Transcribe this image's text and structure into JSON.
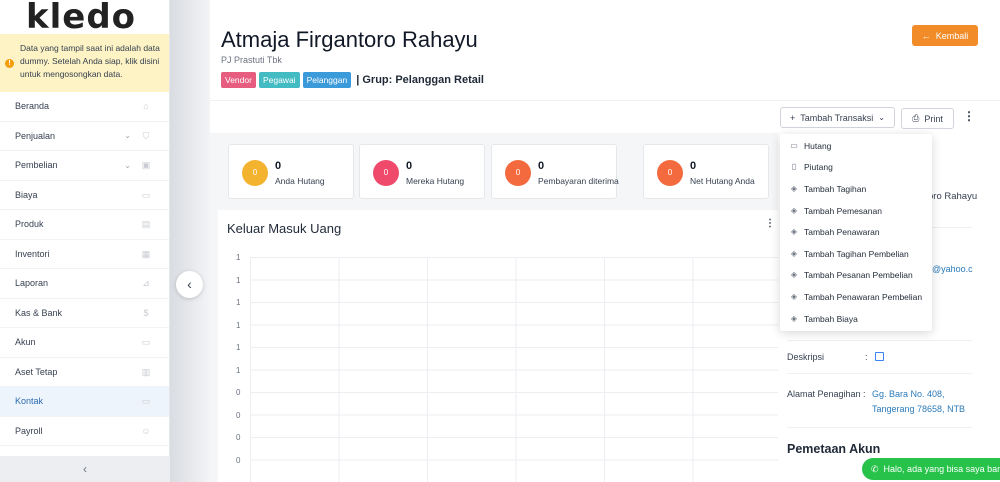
{
  "logo": "kledo",
  "notice": {
    "text": "Data yang tampil saat ini adalah data dummy. Setelah Anda siap, klik disini untuk mengosongkan data."
  },
  "sidebar": {
    "items": [
      {
        "label": "Beranda",
        "icon": "home-icon",
        "chevron": ""
      },
      {
        "label": "Penjualan",
        "icon": "basket-icon",
        "chevron": "⌄"
      },
      {
        "label": "Pembelian",
        "icon": "bag-icon",
        "chevron": "⌄"
      },
      {
        "label": "Biaya",
        "icon": "card-icon",
        "chevron": ""
      },
      {
        "label": "Produk",
        "icon": "box-icon",
        "chevron": ""
      },
      {
        "label": "Inventori",
        "icon": "inventory-icon",
        "chevron": ""
      },
      {
        "label": "Laporan",
        "icon": "chart-icon",
        "chevron": ""
      },
      {
        "label": "Kas & Bank",
        "icon": "dollar-icon",
        "chevron": ""
      },
      {
        "label": "Akun",
        "icon": "book-icon",
        "chevron": ""
      },
      {
        "label": "Aset Tetap",
        "icon": "building-icon",
        "chevron": ""
      },
      {
        "label": "Kontak",
        "icon": "contact-icon",
        "chevron": ""
      },
      {
        "label": "Payroll",
        "icon": "payroll-icon",
        "chevron": ""
      }
    ],
    "active_index": 10,
    "collapse_glyph": "‹"
  },
  "header": {
    "title": "Atmaja Firgantoro Rahayu",
    "subtitle": "PJ Prastuti Tbk",
    "tags": [
      "Vendor",
      "Pegawai",
      "Pelanggan"
    ],
    "group": "| Grup: Pelanggan Retail",
    "back_label": "Kembali"
  },
  "toolbar": {
    "tambah_label": "Tambah Transaksi",
    "print_label": "Print"
  },
  "stats": [
    {
      "value": "0",
      "label": "Anda Hutang",
      "circle_text": "0",
      "color": "#f4b32e"
    },
    {
      "value": "0",
      "label": "Mereka Hutang",
      "circle_text": "0",
      "color": "#ef4a6c"
    },
    {
      "value": "0",
      "label": "Pembayaran diterima",
      "circle_text": "0",
      "color": "#f26a3e"
    },
    {
      "value": "0",
      "label": "Net Hutang Anda",
      "circle_text": "0",
      "color": "#f26a3e"
    }
  ],
  "chart_data": {
    "type": "line",
    "title": "Keluar Masuk Uang",
    "y_tick_labels": [
      "1",
      "1",
      "1",
      "1",
      "1",
      "1",
      "0",
      "0",
      "0",
      "0"
    ],
    "grid": true
  },
  "contact_info": {
    "name_partial": "oro Rahayu",
    "email_partial": "@yahoo.c",
    "deskripsi_label": "Deskripsi",
    "alamat_label": "Alamat Penagihan",
    "alamat_value_1": "Gg. Bara No. 408,",
    "alamat_value_2": "Tangerang 78658, NTB",
    "pemetaan_title": "Pemetaan Akun",
    "colon": ":"
  },
  "dropdown": {
    "items": [
      {
        "label": "Hutang",
        "icon": "card-icon"
      },
      {
        "label": "Piutang",
        "icon": "document-icon"
      },
      {
        "label": "Tambah Tagihan",
        "icon": "tag-icon"
      },
      {
        "label": "Tambah Pemesanan",
        "icon": "tag-icon"
      },
      {
        "label": "Tambah Penawaran",
        "icon": "tag-icon"
      },
      {
        "label": "Tambah Tagihan Pembelian",
        "icon": "tag-icon"
      },
      {
        "label": "Tambah Pesanan Pembelian",
        "icon": "tag-icon"
      },
      {
        "label": "Tambah Penawaran Pembelian",
        "icon": "tag-icon"
      },
      {
        "label": "Tambah Biaya",
        "icon": "tag-icon"
      }
    ]
  },
  "chat": {
    "label": "Halo, ada yang bisa saya bant"
  }
}
